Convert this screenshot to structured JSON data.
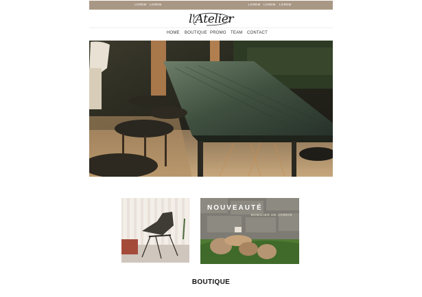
{
  "topbar": {
    "links": [
      "LOREM",
      "LOREM",
      "LOREM",
      "LOREM",
      "LOREM"
    ]
  },
  "logo": {
    "text": "l'Atelier"
  },
  "nav": {
    "items": [
      "HOME",
      "BOUTIQUE",
      "PROMO",
      "TEAM",
      "CONTACT"
    ]
  },
  "promo": {
    "title": "NOUVEAUTÉ",
    "subtitle": "MOBILIER DE JARDIN"
  },
  "section": {
    "title": "BOUTIQUE"
  },
  "colors": {
    "topbar": "#a99785",
    "accent_text": "#1b1b1b"
  }
}
